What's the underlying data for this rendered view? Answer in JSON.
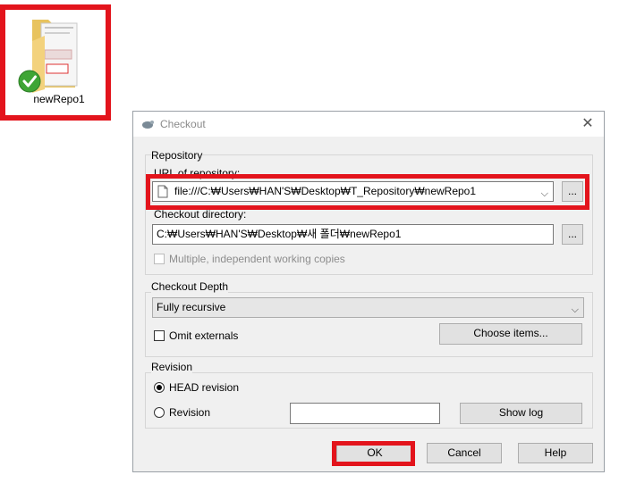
{
  "desktop": {
    "icon_label": "newRepo1"
  },
  "dialog": {
    "title": "Checkout",
    "close_glyph": "✕",
    "repository": {
      "group_label": "Repository",
      "url_label": "URL of repository:",
      "url_value": "file:///C:₩Users₩HAN'S₩Desktop₩T_Repository₩newRepo1",
      "browse_label": "...",
      "checkout_dir_label": "Checkout directory:",
      "checkout_dir_value": "C:₩Users₩HAN'S₩Desktop₩새 폴더₩newRepo1",
      "browse2_label": "...",
      "multiple_label": "Multiple, independent working copies"
    },
    "depth": {
      "group_label": "Checkout Depth",
      "selected": "Fully recursive",
      "omit_label": "Omit externals",
      "choose_label": "Choose items..."
    },
    "revision": {
      "group_label": "Revision",
      "head_label": "HEAD revision",
      "rev_label": "Revision",
      "rev_value": "",
      "showlog_label": "Show log"
    },
    "ok_label": "OK",
    "cancel_label": "Cancel",
    "help_label": "Help"
  },
  "colors": {
    "highlight": "#e3141c",
    "dialog_bg": "#f0f0f0"
  }
}
